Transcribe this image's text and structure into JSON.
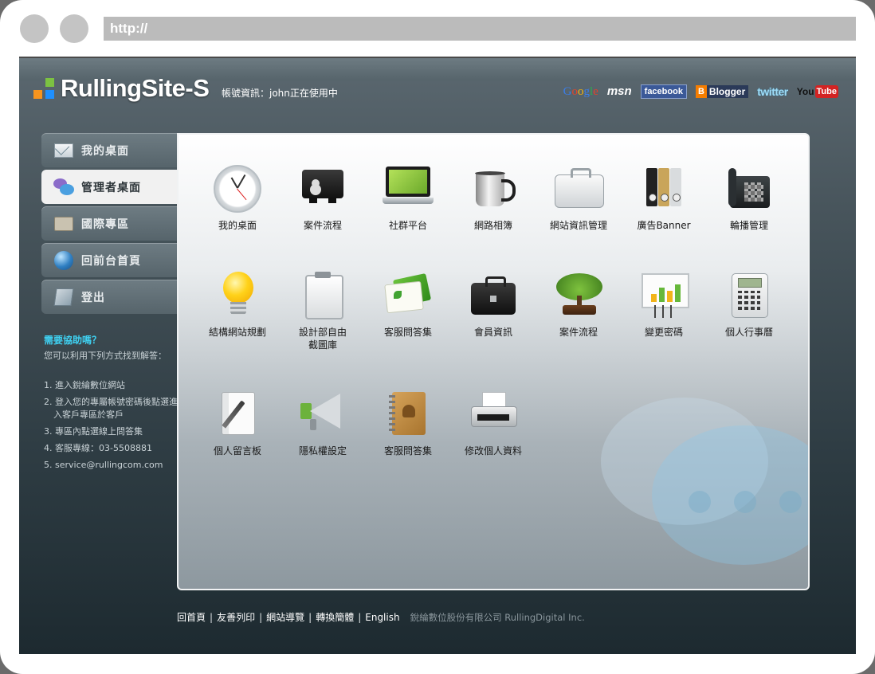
{
  "browser": {
    "url": "http://"
  },
  "header": {
    "logo_text": "RullingSite-S",
    "account": "帳號資訊：john正在使用中"
  },
  "social": {
    "google": [
      "G",
      "o",
      "o",
      "g",
      "l",
      "e"
    ],
    "msn": "msn",
    "facebook": "facebook",
    "blogger_mark": "B",
    "blogger": "Blogger",
    "twitter": "twitter",
    "youtube_you": "You",
    "youtube_tube": "Tube"
  },
  "nav": [
    {
      "label": "我的桌面",
      "icon": "mail-icon",
      "active": false
    },
    {
      "label": "管理者桌面",
      "icon": "chat-bubbles-icon",
      "active": true
    },
    {
      "label": "國際專區",
      "icon": "id-card-icon",
      "active": false
    },
    {
      "label": "回前台首頁",
      "icon": "globe-icon",
      "active": false
    },
    {
      "label": "登出",
      "icon": "pen-notepad-icon",
      "active": false
    }
  ],
  "help": {
    "title": "需要協助嗎？",
    "subtitle": "您可以利用下列方式找到解答：",
    "items": [
      "1. 進入銳綸數位網站",
      "2. 登入您的專屬帳號密碼後點選進入客戶專區於客戶",
      "3. 專區內點選線上問答集",
      "4. 客服專線：03-5508881",
      "5. service@rullingcom.com"
    ]
  },
  "tiles": [
    {
      "label": "我的桌面",
      "icon": "clock-icon"
    },
    {
      "label": "案件流程",
      "icon": "business-cards-icon"
    },
    {
      "label": "社群平台",
      "icon": "laptop-icon"
    },
    {
      "label": "網路相簿",
      "icon": "mug-icon"
    },
    {
      "label": "網站資訊管理",
      "icon": "briefcase-icon"
    },
    {
      "label": "廣告Banner",
      "icon": "binders-icon"
    },
    {
      "label": "輪播管理",
      "icon": "phone-icon"
    },
    {
      "label": "結構網站規劃",
      "icon": "lightbulb-icon"
    },
    {
      "label": "設計部自由截圖庫",
      "icon": "clipboard-icon"
    },
    {
      "label": "客服問答集",
      "icon": "notes-icon"
    },
    {
      "label": "會員資訊",
      "icon": "bag-icon"
    },
    {
      "label": "案件流程",
      "icon": "bonsai-icon"
    },
    {
      "label": "變更密碼",
      "icon": "chart-board-icon"
    },
    {
      "label": "個人行事曆",
      "icon": "calculator-icon"
    },
    {
      "label": "個人留言板",
      "icon": "notebook-pen-icon"
    },
    {
      "label": "隱私權設定",
      "icon": "megaphone-icon"
    },
    {
      "label": "客服問答集",
      "icon": "address-book-icon"
    },
    {
      "label": "修改個人資料",
      "icon": "printer-icon"
    }
  ],
  "footer": {
    "links": [
      "回首頁",
      "友善列印",
      "網站導覽",
      "轉換簡體",
      "English"
    ],
    "separator": "|",
    "copyright": "銳綸數位股份有限公司 RullingDigital Inc."
  }
}
